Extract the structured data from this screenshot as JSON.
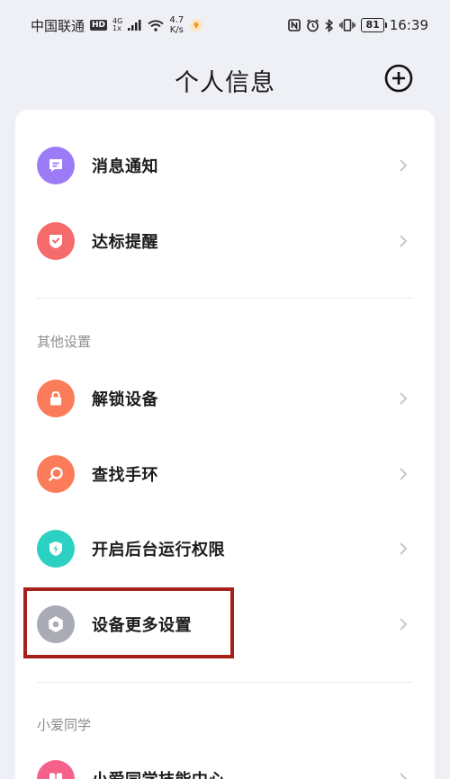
{
  "status_bar": {
    "carrier": "中国联通",
    "hd_badge": "HD",
    "network_top": "4G",
    "network_bottom": "1x",
    "speed_value": "4.7",
    "speed_unit": "K/s",
    "battery": "81",
    "time": "16:39"
  },
  "header": {
    "title": "个人信息"
  },
  "notifications": {
    "items": [
      {
        "label": "消息通知",
        "icon": "message-icon",
        "color": "#9b7cf6"
      },
      {
        "label": "达标提醒",
        "icon": "badge-check-icon",
        "color": "#f56a6a"
      }
    ]
  },
  "other_settings": {
    "title": "其他设置",
    "items": [
      {
        "label": "解锁设备",
        "icon": "lock-icon",
        "color": "#fb7c5a"
      },
      {
        "label": "查找手环",
        "icon": "search-icon",
        "color": "#fb7c5a"
      },
      {
        "label": "开启后台运行权限",
        "icon": "shield-bolt-icon",
        "color": "#2dd1c4"
      },
      {
        "label": "设备更多设置",
        "icon": "hex-gear-icon",
        "color": "#a9acb5"
      }
    ]
  },
  "xiaoai": {
    "title": "小爱同学",
    "items": [
      {
        "label": "小爱同学技能中心",
        "icon": "book-icon",
        "color": "#f5618b"
      }
    ]
  }
}
